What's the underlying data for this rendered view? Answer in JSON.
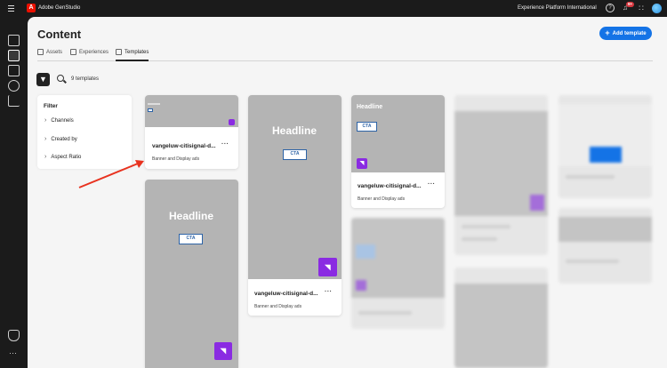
{
  "topbar": {
    "app_name": "Adobe GenStudio",
    "logo_letter": "A",
    "org_name": "Experience Platform International",
    "notification_count": "9+",
    "icons": [
      "menu-icon",
      "help-icon",
      "bell-icon",
      "apps-grid-icon",
      "avatar"
    ]
  },
  "rail": {
    "icons": [
      "home-icon",
      "content-icon",
      "create-icon",
      "insights-icon",
      "analytics-icon",
      "shield-icon",
      "more-icon"
    ],
    "more": "···"
  },
  "page": {
    "title": "Content",
    "add_button": "Add template",
    "add_icon": "+"
  },
  "tabs": [
    {
      "label": "Assets",
      "icon": "assets-icon"
    },
    {
      "label": "Experiences",
      "icon": "experiences-icon"
    },
    {
      "label": "Templates",
      "icon": "templates-icon",
      "selected": true
    }
  ],
  "toolbar": {
    "filter_icon": "filter-icon",
    "search_icon": "search-icon",
    "count": "9 templates"
  },
  "filter_panel": {
    "title": "Filter",
    "items": [
      "Channels",
      "Created by",
      "Aspect Ratio"
    ],
    "chevron": "›"
  },
  "cards": [
    {
      "name": "vangeluw-citisignal-d...",
      "meta": "Banner and Display ads",
      "headline": "",
      "cta": ""
    },
    {
      "name": "",
      "meta": "",
      "headline": "Headline",
      "cta": "CTA"
    },
    {
      "name": "vangeluw-citisignal-d...",
      "meta": "Banner and Display ads",
      "headline": "Headline",
      "cta": "CTA"
    },
    {
      "name": "vangeluw-citisignal-d...",
      "meta": "Banner and Display ads",
      "headline": "Headline",
      "cta": "CTA"
    }
  ],
  "more_label": "···",
  "colors": {
    "accent": "#1473e6",
    "badge": "#8a2be2",
    "arrow": "#e8321f"
  }
}
